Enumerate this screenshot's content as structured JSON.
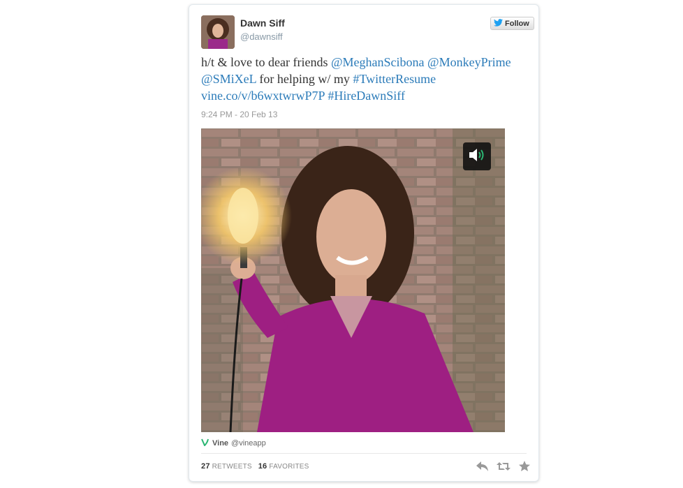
{
  "tweet": {
    "author": {
      "name": "Dawn Siff",
      "handle": "@dawnsiff"
    },
    "follow_label": "Follow",
    "text": {
      "intro": "h/t & love to dear friends",
      "mention1": "@MeghanScibona",
      "mention2": "@MonkeyPrime",
      "mention3": "@SMiXeL",
      "middle": "for helping w/ my",
      "hashtag1": "#TwitterResume",
      "link": "vine.co/v/b6wxtwrwP7P",
      "hashtag2": "#HireDawnSiff"
    },
    "timestamp": "9:24 PM - 20 Feb 13",
    "media": {
      "sound_icon": "speaker-icon"
    },
    "attribution": {
      "service": "Vine",
      "account": "@vineapp"
    },
    "stats": {
      "retweets_count": "27",
      "retweets_label": "RETWEETS",
      "favorites_count": "16",
      "favorites_label": "FAVORITES"
    },
    "actions": {
      "reply_icon": "reply-icon",
      "retweet_icon": "retweet-icon",
      "favorite_icon": "star-icon"
    }
  },
  "colors": {
    "link": "#2b7bb9",
    "vine_green": "#2bb673",
    "twitter_blue": "#1da1f2"
  }
}
